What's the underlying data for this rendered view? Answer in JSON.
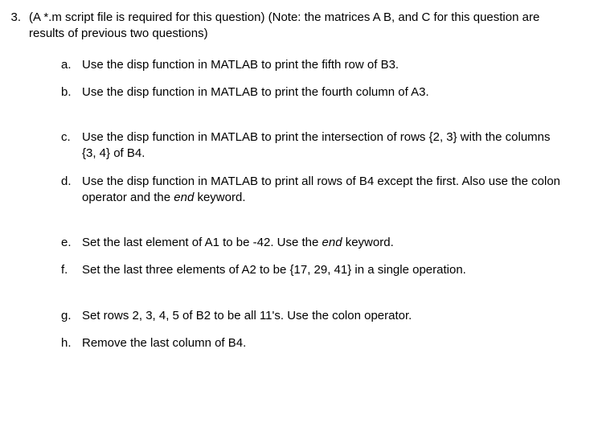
{
  "question": {
    "number": "3.",
    "text_part1": "(A *.m script file is required for this question) (Note: the matrices A B, and C for this question are results of previous two questions)"
  },
  "items": {
    "a": {
      "letter": "a.",
      "text": "Use the disp function in MATLAB to print the fifth row of B3."
    },
    "b": {
      "letter": "b.",
      "text": "Use the disp function in MATLAB to print the fourth column of A3."
    },
    "c": {
      "letter": "c.",
      "text": "Use the disp function in MATLAB to print the intersection of rows {2, 3} with the columns {3, 4} of B4."
    },
    "d": {
      "letter": "d.",
      "text_before": "Use the disp function in MATLAB to print all rows of B4 except the first. Also use the colon operator and the ",
      "italic": "end",
      "text_after": " keyword."
    },
    "e": {
      "letter": "e.",
      "text_before": "Set the last element of A1 to be -42. Use the ",
      "italic": "end",
      "text_after": " keyword."
    },
    "f": {
      "letter": "f.",
      "text": "Set the last three elements of A2 to be {17, 29, 41} in a single operation."
    },
    "g": {
      "letter": "g.",
      "text": "Set rows 2, 3, 4, 5 of B2 to be all 11's. Use the colon operator."
    },
    "h": {
      "letter": "h.",
      "text": "Remove the last column of B4."
    }
  }
}
